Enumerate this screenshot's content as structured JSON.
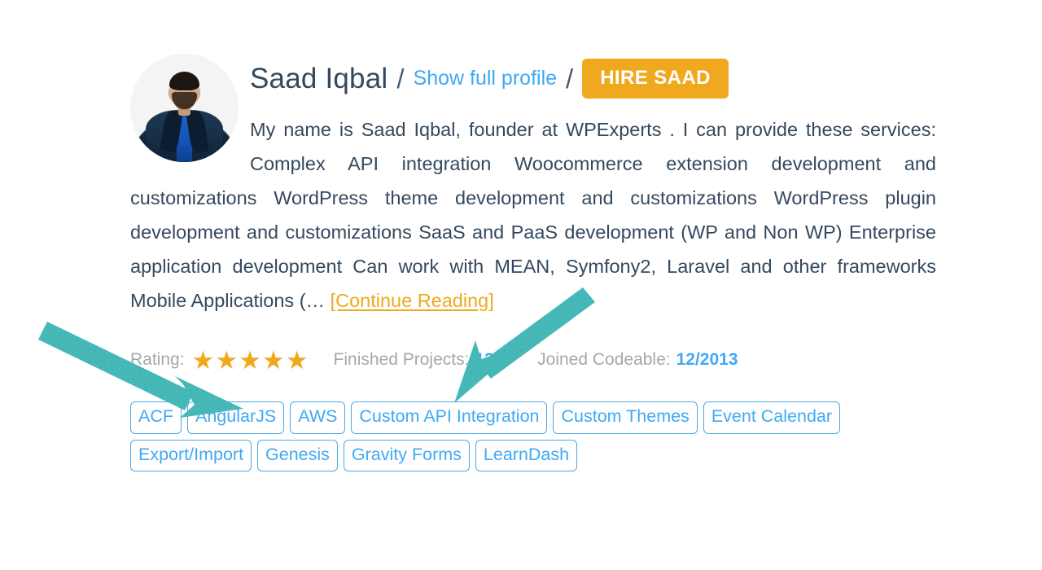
{
  "profile": {
    "avatar_alt": "Saad Iqbal profile photo",
    "name": "Saad Iqbal",
    "separator": "/",
    "show_profile_label": "Show full profile",
    "hire_button_label": "HIRE SAAD",
    "bio_text": "My name is Saad Iqbal, founder at WPExperts . I can provide these services: Complex API integration Woocommerce extension development and customizations WordPress theme development and customizations WordPress plugin development and customizations SaaS and PaaS development (WP and Non WP) Enterprise application development Can work with MEAN, Symfony2, Laravel and other frameworks Mobile Applications (…",
    "continue_link_label": "[Continue Reading]"
  },
  "meta": {
    "rating_label": "Rating:",
    "rating_stars": "★★★★★",
    "rating_value": 5,
    "finished_projects_label": "Finished Projects:",
    "finished_projects_value": "1359",
    "joined_label": "Joined Codeable:",
    "joined_value": "12/2013"
  },
  "tags": [
    "ACF",
    "AngularJS",
    "AWS",
    "Custom API Integration",
    "Custom Themes",
    "Event Calendar",
    "Export/Import",
    "Genesis",
    "Gravity Forms",
    "LearnDash"
  ],
  "annotations": {
    "arrow_color": "#47b8b8",
    "arrow_1_target": "rating-stars",
    "arrow_2_target": "finished-projects-value"
  },
  "colors": {
    "name_text": "#34495e",
    "link_blue": "#3fa9f5",
    "accent_orange": "#f0a81f",
    "muted_gray": "#a3a9ad",
    "tag_border": "#4aa9e8",
    "background": "#ffffff",
    "arrow_teal": "#47b8b8"
  }
}
